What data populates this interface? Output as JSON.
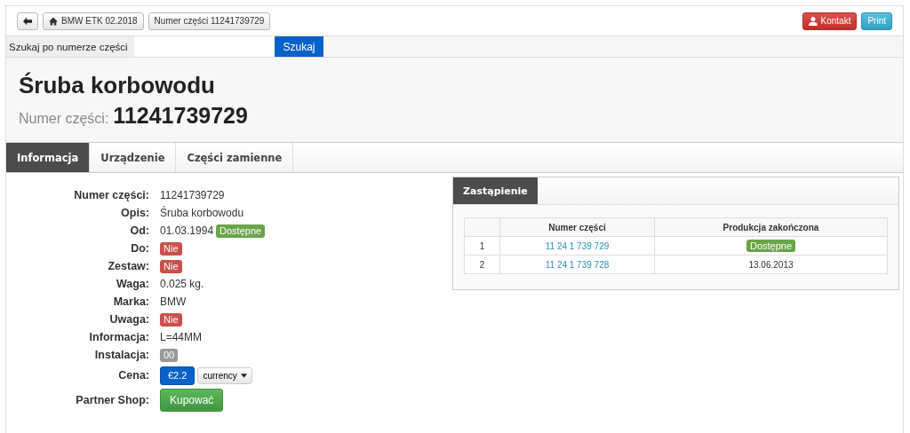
{
  "toolbar": {
    "breadcrumbs": [
      {
        "label": "BMW ETK 02.2018",
        "kind": "home"
      },
      {
        "label": "Numer części 11241739729",
        "kind": "plain"
      }
    ],
    "actions": [
      {
        "label": "Kontakt",
        "kind": "contact"
      },
      {
        "label": "Print",
        "kind": "print"
      }
    ]
  },
  "search": {
    "label": "Szukaj po numerze części",
    "button": "Szukaj"
  },
  "header": {
    "title": "Śruba korbowodu",
    "subtitle_label": "Numer części:",
    "part_number": "11241739729"
  },
  "tabs": [
    {
      "label": "Informacja",
      "selected": true
    },
    {
      "label": "Urządzenie",
      "selected": false
    },
    {
      "label": "Części zamienne",
      "selected": false
    }
  ],
  "details": [
    {
      "label": "Numer części:",
      "values": [
        {
          "kind": "text",
          "text": "11241739729"
        }
      ]
    },
    {
      "label": "Opis:",
      "values": [
        {
          "kind": "text",
          "text": "Śruba korbowodu"
        }
      ]
    },
    {
      "label": "Od:",
      "values": [
        {
          "kind": "text",
          "text": "01.03.1994"
        },
        {
          "kind": "badge",
          "text": "Dostępne",
          "color": "#6aa548"
        }
      ]
    },
    {
      "label": "Do:",
      "values": [
        {
          "kind": "badge",
          "text": "Nie",
          "color": "#c9504c"
        }
      ]
    },
    {
      "label": "Zestaw:",
      "values": [
        {
          "kind": "badge",
          "text": "Nie",
          "color": "#c9504c"
        }
      ]
    },
    {
      "label": "Waga:",
      "values": [
        {
          "kind": "text",
          "text": "0.025 kg."
        }
      ]
    },
    {
      "label": "Marka:",
      "values": [
        {
          "kind": "text",
          "text": "BMW"
        }
      ]
    },
    {
      "label": "Uwaga:",
      "values": [
        {
          "kind": "badge",
          "text": "Nie",
          "color": "#c9504c"
        }
      ]
    },
    {
      "label": "Informacja:",
      "values": [
        {
          "kind": "text",
          "text": "L=44MM"
        }
      ]
    },
    {
      "label": "Instalacja:",
      "values": [
        {
          "kind": "badge",
          "text": "00",
          "color": "#999999"
        }
      ]
    },
    {
      "label": "Cena:",
      "values": [
        {
          "kind": "price",
          "text": "€2.2"
        },
        {
          "kind": "dropdown",
          "text": "currency"
        }
      ]
    },
    {
      "label": "Partner Shop:",
      "values": [
        {
          "kind": "buy",
          "text": "Kupować"
        }
      ]
    }
  ],
  "replacement": {
    "tab": "Zastąpienie",
    "columns": [
      "Numer części",
      "Produkcja zakończona"
    ],
    "rows": [
      {
        "index": "1",
        "part": "11 24 1 739 729",
        "end": {
          "kind": "badge",
          "text": "Dostępne",
          "color": "#6aa548"
        }
      },
      {
        "index": "2",
        "part": "11 24 1 739 728",
        "end": {
          "kind": "text",
          "text": "13.06.2013"
        }
      }
    ]
  }
}
